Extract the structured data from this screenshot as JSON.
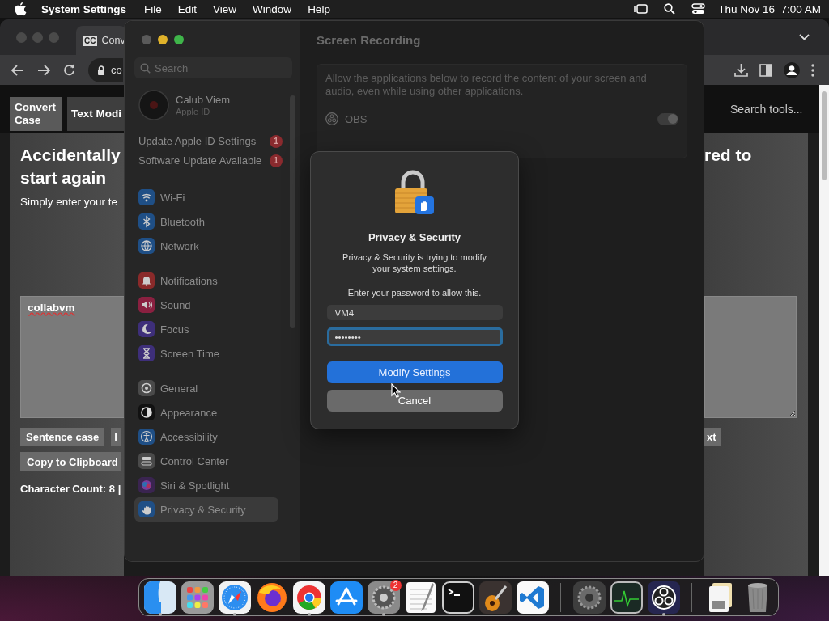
{
  "menubar": {
    "app": "System Settings",
    "menus": [
      "File",
      "Edit",
      "View",
      "Window",
      "Help"
    ],
    "clock": "Thu Nov 16  7:00 AM"
  },
  "browser": {
    "tab_title": "Conv",
    "favicon": "CC",
    "address": "co",
    "site_tabs": [
      {
        "label": "Convert Case",
        "selected": true
      },
      {
        "label": "Text Modi",
        "selected": false
      }
    ],
    "search_field": {
      "placeholder": "Search tools..."
    },
    "heading_left": [
      "Accidentally",
      "start again"
    ],
    "heading_right": "red to",
    "intro": "Simply enter your te",
    "textarea_value": "collabvm",
    "buttons_left": [
      "Sentence case",
      "l"
    ],
    "buttons_right": [
      "xt"
    ],
    "copy_button": "Copy to Clipboard",
    "count": "Character Count: 8 |"
  },
  "settings": {
    "search": {
      "placeholder": "Search"
    },
    "account": {
      "name": "Calub Viem",
      "subtitle": "Apple ID"
    },
    "alerts": [
      {
        "label": "Update Apple ID Settings",
        "badge": "1"
      },
      {
        "label": "Software Update Available",
        "badge": "1"
      }
    ],
    "groups": [
      {
        "items": [
          {
            "label": "Wi-Fi",
            "color": "#1f4f86",
            "selected": false
          },
          {
            "label": "Bluetooth",
            "color": "#1f4f86",
            "selected": false
          },
          {
            "label": "Network",
            "color": "#1f4f86",
            "selected": false
          }
        ]
      },
      {
        "items": [
          {
            "label": "Notifications",
            "color": "#8a2a2a",
            "selected": false
          },
          {
            "label": "Sound",
            "color": "#8a2040",
            "selected": false
          },
          {
            "label": "Focus",
            "color": "#3e2f7a",
            "selected": false
          },
          {
            "label": "Screen Time",
            "color": "#3e2f7a",
            "selected": false
          }
        ]
      },
      {
        "items": [
          {
            "label": "General",
            "color": "#4a4a4a",
            "selected": false
          },
          {
            "label": "Appearance",
            "color": "#111111",
            "selected": false
          },
          {
            "label": "Accessibility",
            "color": "#1f4f86",
            "selected": false
          },
          {
            "label": "Control Center",
            "color": "#4a4a4a",
            "selected": false
          },
          {
            "label": "Siri & Spotlight",
            "color": "#3a2450",
            "selected": false
          },
          {
            "label": "Privacy & Security",
            "color": "#1f4f86",
            "selected": true
          }
        ]
      }
    ]
  },
  "pane": {
    "title": "Screen Recording",
    "description": "Allow the applications below to record the content of your screen and audio, even while using other applications.",
    "apps": [
      {
        "name": "OBS",
        "on": true
      }
    ]
  },
  "dialog": {
    "title": "Privacy & Security",
    "message": "Privacy & Security is trying to modify your system settings.",
    "prompt": "Enter your password to allow this.",
    "username": "VM4",
    "password": "••••••••",
    "buttons": [
      {
        "label": "Modify Settings",
        "kind": "primary"
      },
      {
        "label": "Cancel",
        "kind": "secondary"
      }
    ]
  },
  "dock": {
    "items": [
      {
        "running": true
      },
      {
        "running": false
      },
      {
        "running": true
      },
      {
        "running": false
      },
      {
        "running": true
      },
      {
        "running": false
      },
      {
        "running": true,
        "badge": "2"
      },
      {
        "running": false
      },
      {
        "running": false
      },
      {
        "running": false
      },
      {
        "running": false
      },
      {
        "running": false
      },
      {
        "running": false
      },
      {
        "running": true
      },
      {
        "running": false
      },
      {
        "running": false
      }
    ]
  }
}
